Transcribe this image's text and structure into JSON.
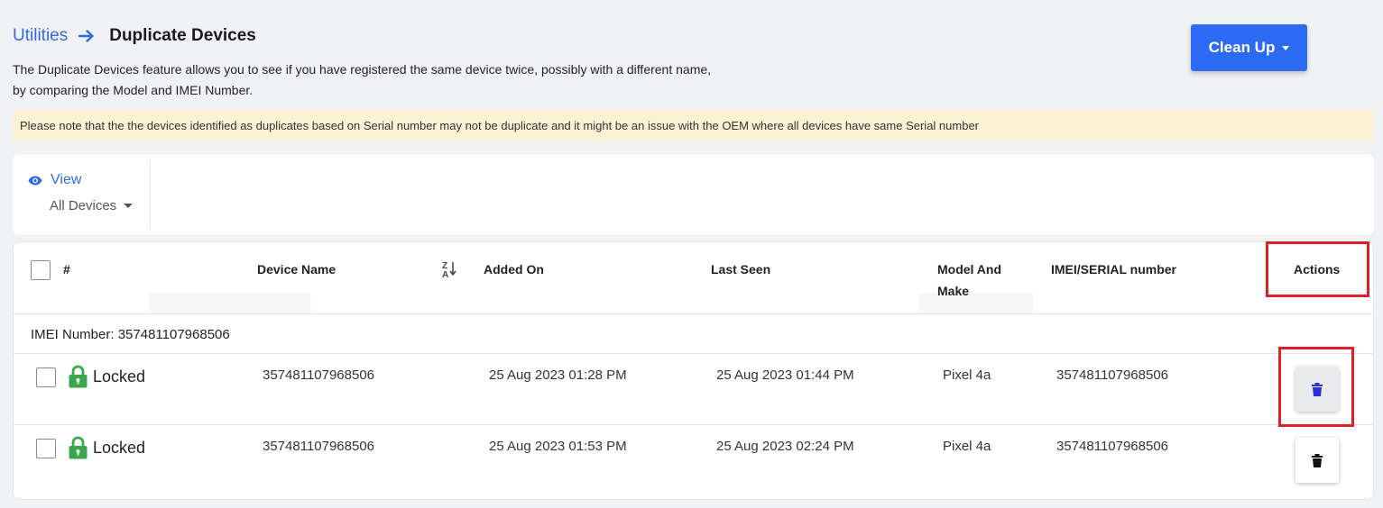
{
  "breadcrumb": {
    "parent": "Utilities",
    "current": "Duplicate Devices"
  },
  "description": {
    "line1": "The Duplicate Devices feature allows you to see if you have registered the same device twice, possibly with a different name,",
    "line2": "by comparing the Model and IMEI Number."
  },
  "cleanup_button": {
    "label": "Clean Up"
  },
  "notice": "Please note that the the devices identified as duplicates based on Serial number may not be duplicate and it might be an issue with the OEM where all devices have same Serial number",
  "view": {
    "label": "View",
    "selected": "All Devices"
  },
  "table": {
    "columns": {
      "number": "#",
      "device_name": "Device Name",
      "added_on": "Added On",
      "last_seen": "Last Seen",
      "model_line1": "Model And",
      "model_line2": "Make",
      "imei": "IMEI/SERIAL number",
      "actions": "Actions"
    },
    "group": {
      "label": "IMEI Number:",
      "value": "357481107968506"
    },
    "rows": [
      {
        "status": "Locked",
        "device_name": "357481107968506",
        "added_on": "25 Aug 2023 01:28 PM",
        "last_seen": "25 Aug 2023 01:44 PM",
        "model": "Pixel 4a",
        "imei": "357481107968506"
      },
      {
        "status": "Locked",
        "device_name": "357481107968506",
        "added_on": "25 Aug 2023 01:53 PM",
        "last_seen": "25 Aug 2023 02:24 PM",
        "model": "Pixel 4a",
        "imei": "357481107968506"
      }
    ]
  },
  "icons": {
    "breadcrumb_arrow": "arrow-right-icon",
    "view": "eye-icon",
    "sort": "sort-za-icon",
    "lock": "lock-icon",
    "delete": "trash-icon"
  },
  "colors": {
    "accent": "#2f6be6",
    "primary_button": "#2d6bf4",
    "lock_green": "#3aa84a",
    "trash_active": "#2d2ed6",
    "trash_default": "#111111",
    "notice_bg": "#fbf1d3",
    "highlight": "#e11f26"
  }
}
